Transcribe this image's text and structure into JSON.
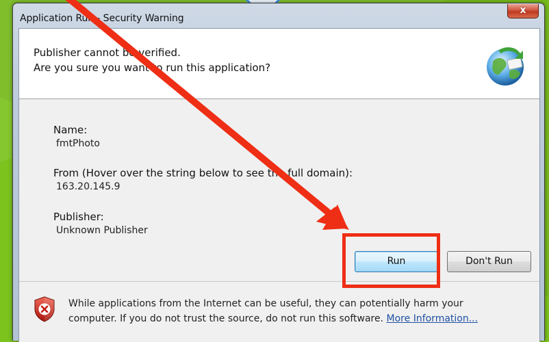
{
  "window": {
    "title": "Application Run - Security Warning",
    "close_label": "x"
  },
  "header": {
    "line1": "Publisher cannot be verified.",
    "line2": "Are you sure you want to run this application?",
    "icon": "globe-icon"
  },
  "details": {
    "name_label": "Name:",
    "name_value": "fmtPhoto",
    "from_label": "From (Hover over the string below to see the full domain):",
    "from_value": "163.20.145.9",
    "publisher_label": "Publisher:",
    "publisher_value": "Unknown Publisher"
  },
  "buttons": {
    "run": "Run",
    "dont_run": "Don't Run"
  },
  "footer": {
    "icon": "shield-warning-icon",
    "line1": "While applications from the Internet can be useful, they can potentially harm your",
    "line2": "computer. If you do not trust the source, do not run this software.",
    "link": "More Information..."
  },
  "annotation": {
    "color": "#ee2e15",
    "arrow": "red-arrow-icon",
    "highlight": "run-button"
  },
  "colors": {
    "background": "#7cc31e",
    "default_button": "#bee6fd",
    "link": "#1e50a2"
  }
}
